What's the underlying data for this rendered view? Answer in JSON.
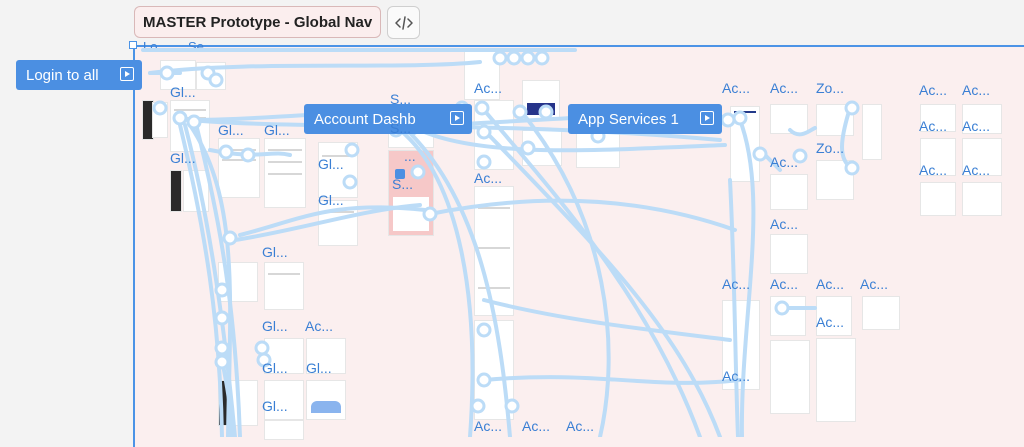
{
  "header": {
    "file_title": "MASTER Prototype - Global Nav",
    "code_icon": "code-icon"
  },
  "section": {
    "labels": [
      "Lo...",
      "Se..."
    ]
  },
  "flow_starts": [
    {
      "label": "Login to all"
    },
    {
      "label": "Account Dashb"
    },
    {
      "label": "App Services 1"
    }
  ],
  "frame_labels": [
    "Gl...",
    "Gl...",
    "Gl...",
    "Gl...",
    "Gl...",
    "Gl...",
    "Gl...",
    "Gl...",
    "Gl...",
    "Gl...",
    "Gl...",
    "S...",
    "S...",
    "...",
    "S...",
    "Ac...",
    "Ac...",
    "Ac...",
    "Ac...",
    "Ac...",
    "Ac...",
    "Ac...",
    "Ac...",
    "Zo...",
    "Zo...",
    "Ac...",
    "Ac...",
    "Ac...",
    "Ac...",
    "Ac...",
    "Ac...",
    "Ac...",
    "Ac...",
    "Ac...",
    "Ac...",
    "Ac...",
    "Ac...",
    "Ac...",
    "Ac..."
  ],
  "colors": {
    "accent": "#4b8fe2",
    "flow_line": "#bcdcf7",
    "section_bg": "#fbefef"
  }
}
